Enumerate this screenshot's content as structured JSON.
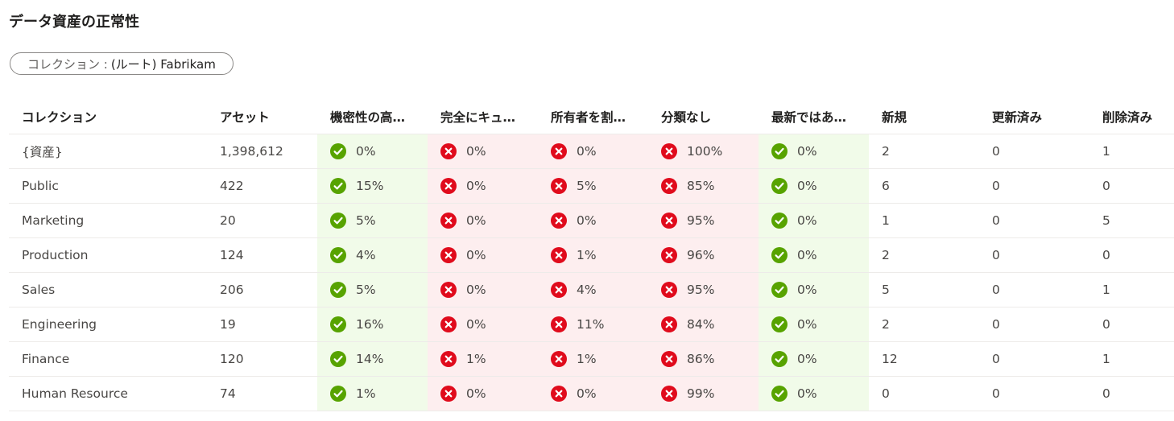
{
  "page": {
    "title": "データ資産の正常性"
  },
  "filter": {
    "prefix": "コレクション : ",
    "value": "(ルート) Fabrikam"
  },
  "table": {
    "columns": [
      "コレクション",
      "アセット",
      "機密性の高…",
      "完全にキュ…",
      "所有者を割…",
      "分類なし",
      "最新ではあ…",
      "新規",
      "更新済み",
      "削除済み"
    ],
    "column_status": [
      "",
      "",
      "ok",
      "bad",
      "bad",
      "bad",
      "ok",
      "",
      "",
      ""
    ],
    "rows": [
      [
        "{資産}",
        "1,398,612",
        "0%",
        "0%",
        "0%",
        "100%",
        "0%",
        "2",
        "0",
        "1"
      ],
      [
        "Public",
        "422",
        "15%",
        "0%",
        "5%",
        "85%",
        "0%",
        "6",
        "0",
        "0"
      ],
      [
        "Marketing",
        "20",
        "5%",
        "0%",
        "0%",
        "95%",
        "0%",
        "1",
        "0",
        "5"
      ],
      [
        "Production",
        "124",
        "4%",
        "0%",
        "1%",
        "96%",
        "0%",
        "2",
        "0",
        "0"
      ],
      [
        "Sales",
        "206",
        "5%",
        "0%",
        "4%",
        "95%",
        "0%",
        "5",
        "0",
        "1"
      ],
      [
        "Engineering",
        "19",
        "16%",
        "0%",
        "11%",
        "84%",
        "0%",
        "2",
        "0",
        "0"
      ],
      [
        "Finance",
        "120",
        "14%",
        "1%",
        "1%",
        "86%",
        "0%",
        "12",
        "0",
        "1"
      ],
      [
        "Human Resource",
        "74",
        "1%",
        "0%",
        "0%",
        "99%",
        "0%",
        "0",
        "0",
        "0"
      ]
    ]
  },
  "icons": {
    "ok": "checkmark-circle-icon",
    "bad": "error-circle-icon"
  },
  "colors": {
    "ok_icon": "#57a300",
    "bad_icon": "#e00b1c",
    "ok_bg": "#f1fbe9",
    "bad_bg": "#fdeeef"
  }
}
